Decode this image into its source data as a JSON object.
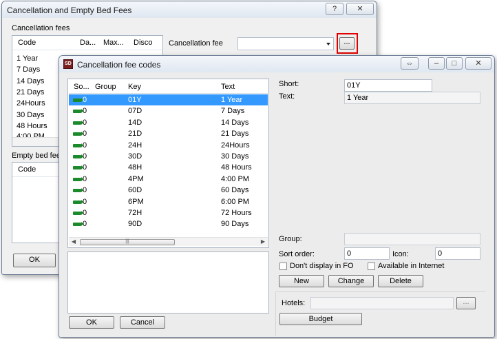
{
  "back_window": {
    "title": "Cancellation and Empty Bed Fees",
    "help_glyph": "?",
    "close_glyph": "✕",
    "group_cancellation_label": "Cancellation fees",
    "columns": [
      "Code",
      "Da...",
      "Max...",
      "Disco"
    ],
    "rows": [
      {
        "code": "1 Year"
      },
      {
        "code": "7 Days"
      },
      {
        "code": "14 Days"
      },
      {
        "code": "21 Days"
      },
      {
        "code": "24Hours"
      },
      {
        "code": "30 Days"
      },
      {
        "code": "48 Hours"
      },
      {
        "code": "4:00 PM"
      }
    ],
    "cancellation_fee_label": "Cancellation fee",
    "cancellation_fee_value": "",
    "ellipsis_button": "...",
    "empty_bed_label": "Empty bed fees",
    "empty_bed_columns": [
      "Code"
    ],
    "ok_button": "OK",
    "highlight_color": "#e00000"
  },
  "front_window": {
    "title": "Cancellation fee codes",
    "app_icon_text": "SD",
    "columns": [
      "So...",
      "Group",
      "Key",
      "Text"
    ],
    "rows": [
      {
        "sort": "0",
        "group": "",
        "key": "01Y",
        "text": "1 Year",
        "selected": true
      },
      {
        "sort": "0",
        "group": "",
        "key": "07D",
        "text": "7 Days",
        "selected": false
      },
      {
        "sort": "0",
        "group": "",
        "key": "14D",
        "text": "14 Days",
        "selected": false
      },
      {
        "sort": "0",
        "group": "",
        "key": "21D",
        "text": "21 Days",
        "selected": false
      },
      {
        "sort": "0",
        "group": "",
        "key": "24H",
        "text": "24Hours",
        "selected": false
      },
      {
        "sort": "0",
        "group": "",
        "key": "30D",
        "text": "30 Days",
        "selected": false
      },
      {
        "sort": "0",
        "group": "",
        "key": "48H",
        "text": "48 Hours",
        "selected": false
      },
      {
        "sort": "0",
        "group": "",
        "key": "4PM",
        "text": "4:00 PM",
        "selected": false
      },
      {
        "sort": "0",
        "group": "",
        "key": "60D",
        "text": "60 Days",
        "selected": false
      },
      {
        "sort": "0",
        "group": "",
        "key": "6PM",
        "text": "6:00 PM",
        "selected": false
      },
      {
        "sort": "0",
        "group": "",
        "key": "72H",
        "text": "72 Hours",
        "selected": false
      },
      {
        "sort": "0",
        "group": "",
        "key": "90D",
        "text": "90 Days",
        "selected": false
      }
    ],
    "short_label": "Short:",
    "short_value": "01Y",
    "text_label": "Text:",
    "text_value": "1 Year",
    "group_label": "Group:",
    "group_value": "",
    "sort_order_label": "Sort order:",
    "sort_order_value": "0",
    "icon_label": "Icon:",
    "icon_value": "0",
    "dont_display_label": "Don't display in FO",
    "available_internet_label": "Available in Internet",
    "new_button": "New",
    "change_button": "Change",
    "delete_button": "Delete",
    "hotels_label": "Hotels:",
    "hotels_value": "",
    "hotels_ellipsis": "...",
    "budget_button": "Budget",
    "ok_button": "OK",
    "cancel_button": "Cancel",
    "selection_color": "#3399ff"
  }
}
